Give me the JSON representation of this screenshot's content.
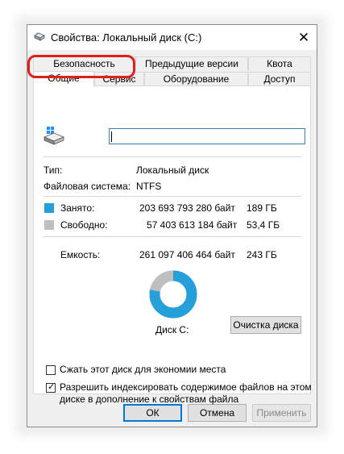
{
  "window": {
    "title": "Свойства: Локальный диск (C:)",
    "close_glyph": "✕"
  },
  "tabs": {
    "row1": [
      {
        "label": "Безопасность",
        "highlighted": true
      },
      {
        "label": "Предыдущие версии"
      },
      {
        "label": "Квота"
      }
    ],
    "row2": [
      {
        "label": "Общие",
        "active": true
      },
      {
        "label": "Сервис"
      },
      {
        "label": "Оборудование"
      },
      {
        "label": "Доступ"
      }
    ]
  },
  "general": {
    "drive_name_value": "",
    "type_label": "Тип:",
    "type_value": "Локальный диск",
    "fs_label": "Файловая система:",
    "fs_value": "NTFS",
    "used": {
      "label": "Занято:",
      "bytes": "203 693 793 280 байт",
      "size": "189 ГБ",
      "color": "#26a0da"
    },
    "free": {
      "label": "Свободно:",
      "bytes": "57 403 613 184 байт",
      "size": "53,4 ГБ",
      "color": "#bfbfbf"
    },
    "capacity": {
      "label": "Емкость:",
      "bytes": "261 097 406 464 байт",
      "size": "243 ГБ"
    },
    "disk_label": "Диск C:",
    "cleanup_button": "Очистка диска",
    "compress_label": "Сжать этот диск для экономии места",
    "compress_checked": false,
    "index_label_line1": "Разрешить индексировать содержимое файлов на этом",
    "index_label_line2": "диске в дополнение к свойствам файла",
    "index_checked": true,
    "checkmark_glyph": "✓"
  },
  "usage_fraction": 0.78,
  "footer": {
    "ok": "ОК",
    "cancel": "Отмена",
    "apply": "Применить",
    "apply_disabled": true
  }
}
